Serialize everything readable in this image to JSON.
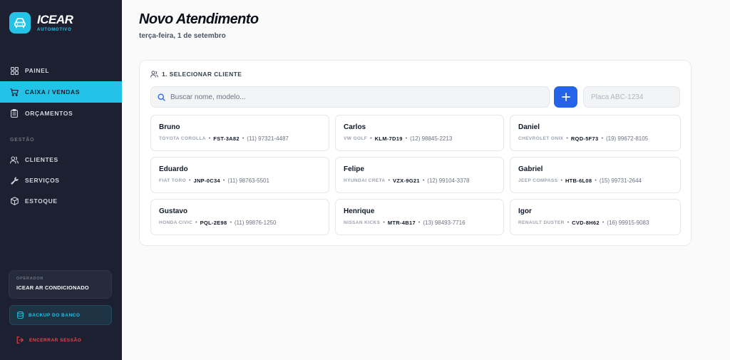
{
  "brand": {
    "name": "ICEAR",
    "subtitle": "AUTOMOTIVO",
    "accent": "#22c3e6"
  },
  "nav": {
    "items": [
      {
        "label": "PAINEL",
        "icon": "grid-icon",
        "active": false
      },
      {
        "label": "CAIXA / VENDAS",
        "icon": "cart-icon",
        "active": true
      },
      {
        "label": "ORÇAMENTOS",
        "icon": "clipboard-icon",
        "active": false
      }
    ],
    "section_label": "GESTÃO",
    "section_items": [
      {
        "label": "CLIENTES",
        "icon": "users-icon"
      },
      {
        "label": "SERVIÇOS",
        "icon": "wrench-icon"
      },
      {
        "label": "ESTOQUE",
        "icon": "box-icon"
      }
    ]
  },
  "operator": {
    "label": "OPERADOR",
    "name": "ICEAR AR CONDICIONADO"
  },
  "backup": {
    "label": "BACKUP DO BANCO",
    "icon": "database-icon"
  },
  "logout": {
    "label": "ENCERRAR SESSÃO",
    "icon": "logout-icon"
  },
  "header": {
    "title": "Novo Atendimento",
    "date": "terça-feira, 1 de setembro"
  },
  "client_section": {
    "title": "1. SELECIONAR CLIENTE",
    "search_placeholder": "Buscar nome, modelo...",
    "plate_placeholder": "Placa ABC-1234",
    "add_color": "#2563eb"
  },
  "clients": [
    {
      "name": "Bruno",
      "model": "TOYOTA COROLLA",
      "plate": "FST-3A82",
      "phone": "(11) 97321-4487"
    },
    {
      "name": "Carlos",
      "model": "VW GOLF",
      "plate": "KLM-7D19",
      "phone": "(12) 98845-2213"
    },
    {
      "name": "Daniel",
      "model": "CHEVROLET ONIX",
      "plate": "RQD-5F73",
      "phone": "(19) 99672-8105"
    },
    {
      "name": "Eduardo",
      "model": "FIAT TORO",
      "plate": "JNP-0C34",
      "phone": "(11) 98763-5501"
    },
    {
      "name": "Felipe",
      "model": "HYUNDAI CRETA",
      "plate": "VZX-9G21",
      "phone": "(12) 99104-3378"
    },
    {
      "name": "Gabriel",
      "model": "JEEP COMPASS",
      "plate": "HTB-6L08",
      "phone": "(15) 99731-2644"
    },
    {
      "name": "Gustavo",
      "model": "HONDA CIVIC",
      "plate": "PQL-2E98",
      "phone": "(11) 99876-1250"
    },
    {
      "name": "Henrique",
      "model": "NISSAN KICKS",
      "plate": "MTR-4B17",
      "phone": "(13) 98493-7716"
    },
    {
      "name": "Igor",
      "model": "RENAULT DUSTER",
      "plate": "CVD-8H62",
      "phone": "(16) 99915-9083"
    }
  ]
}
